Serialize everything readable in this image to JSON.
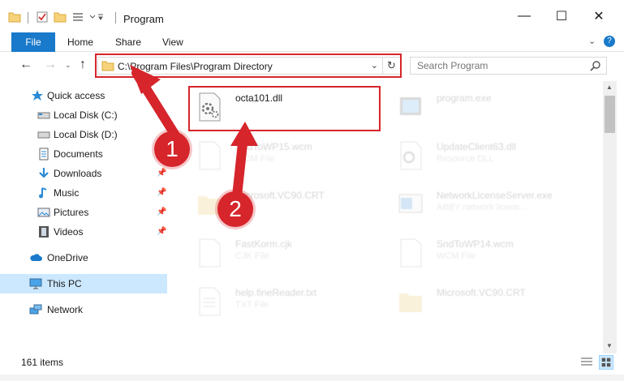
{
  "window": {
    "title": "Program",
    "minimize_glyph": "—",
    "maximize_glyph": "☐",
    "close_glyph": "✕"
  },
  "ribbon": {
    "tabs": [
      "File",
      "Home",
      "Share",
      "View"
    ],
    "help_glyph": "?"
  },
  "nav": {
    "address_path": "C:\\Program Files\\Program Directory",
    "search_placeholder": "Search Program"
  },
  "sidebar": {
    "items": [
      {
        "label": "Quick access",
        "icon": "star-icon"
      },
      {
        "label": "Local Disk (C:)",
        "icon": "drive-icon"
      },
      {
        "label": "Local Disk (D:)",
        "icon": "drive-icon"
      },
      {
        "label": "Documents",
        "icon": "documents-icon"
      },
      {
        "label": "Downloads",
        "icon": "download-icon"
      },
      {
        "label": "Music",
        "icon": "music-icon"
      },
      {
        "label": "Pictures",
        "icon": "pictures-icon"
      },
      {
        "label": "Videos",
        "icon": "videos-icon"
      },
      {
        "label": "OneDrive",
        "icon": "cloud-icon"
      },
      {
        "label": "This PC",
        "icon": "computer-icon"
      },
      {
        "label": "Network",
        "icon": "network-icon"
      }
    ]
  },
  "files": {
    "left": [
      {
        "name": "octa101.dll",
        "type": ""
      },
      {
        "name": "SndToWP15.wcm",
        "type": "WCM File"
      },
      {
        "name": "Microsoft.VC90.CRT",
        "type": ""
      },
      {
        "name": "FastKorm.cjk",
        "type": "CJK File"
      },
      {
        "name": "help.fineReader.txt",
        "type": "TXT File"
      }
    ],
    "right": [
      {
        "name": "program.exe",
        "type": ""
      },
      {
        "name": "UpdateClient63.dll",
        "type": "Resource DLL"
      },
      {
        "name": "NetworkLicenseServer.exe",
        "type": "ABBY network licens..."
      },
      {
        "name": "SndToWP14.wcm",
        "type": "WCM File"
      },
      {
        "name": "Microsoft.VC90.CRT",
        "type": ""
      }
    ]
  },
  "status": {
    "item_count": "161 items"
  },
  "callouts": [
    "1",
    "2"
  ],
  "colors": {
    "accent": "#1979ca",
    "highlight_red": "#d6252b",
    "selected": "#cce8ff"
  }
}
